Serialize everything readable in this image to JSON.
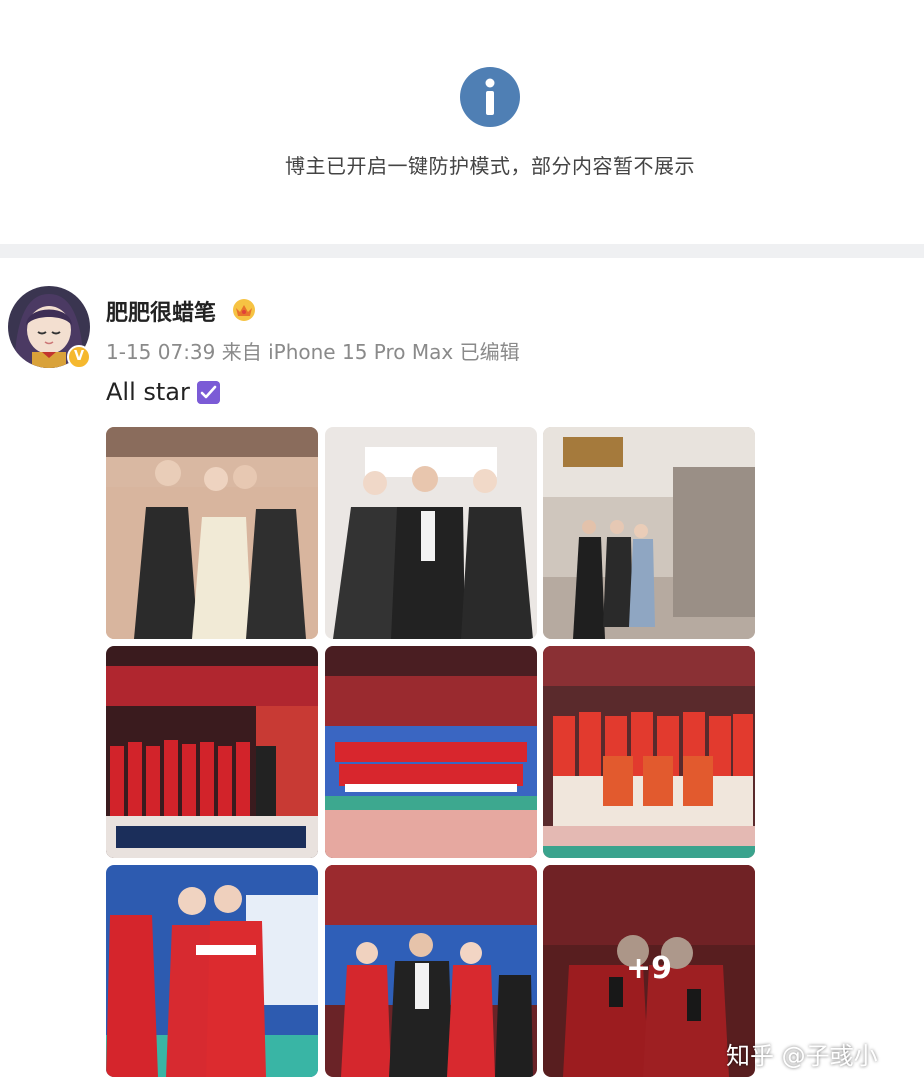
{
  "notice": {
    "icon": "info-icon",
    "icon_color": "#4f7fb4",
    "text": "博主已开启一键防护模式，部分内容暂不展示"
  },
  "post": {
    "username": "肥肥很蜡笔",
    "meta": "1-15 07:39 来自 iPhone 15 Pro Max 已编辑",
    "text": "All star",
    "badge_icon": "crown-badge-icon",
    "verified_icon": "verified-v-icon",
    "verified_label": "V",
    "emoji_icon": "check-box-emoji-icon",
    "more_count": "+9"
  },
  "images": [
    {
      "name": "photo-three-women-backstage"
    },
    {
      "name": "photo-two-women-with-man"
    },
    {
      "name": "photo-lobby-group"
    },
    {
      "name": "photo-team-red-uniforms-stage"
    },
    {
      "name": "photo-team-court-group"
    },
    {
      "name": "photo-team-jerseys-court"
    },
    {
      "name": "photo-two-players-red-jackets"
    },
    {
      "name": "photo-players-with-man"
    },
    {
      "name": "photo-players-holding-phones"
    }
  ],
  "watermark": "知乎 @子彧小",
  "colors": {
    "divider": "#eff0f2",
    "meta_text": "#8a8a8a",
    "emoji_purple": "#7b5bd6"
  }
}
